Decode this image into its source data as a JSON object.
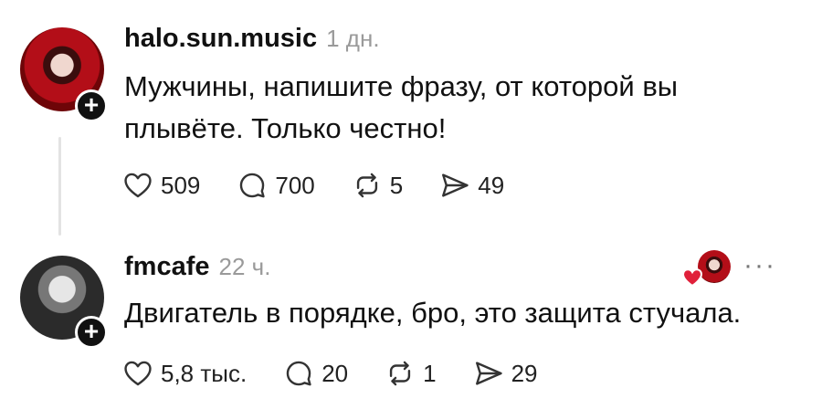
{
  "posts": [
    {
      "username": "halo.sun.music",
      "time": "1 дн.",
      "text": "Мужчины, напишите фразу, от которой вы плывёте. Только честно!",
      "likes": "509",
      "replies": "700",
      "reposts": "5",
      "shares": "49"
    },
    {
      "username": "fmcafe",
      "time": "22 ч.",
      "text": "Двигатель в порядке, бро, это защита стучала.",
      "likes": "5,8 тыс.",
      "replies": "20",
      "reposts": "1",
      "shares": "29"
    }
  ],
  "follow_symbol": "+",
  "more_symbol": "···",
  "colors": {
    "liked_heart": "#e0203a",
    "muted_text": "#9a9a9a",
    "thread_line": "#e3e3e3"
  },
  "icons": [
    "heart-icon",
    "reply-icon",
    "repost-icon",
    "share-icon",
    "plus-icon",
    "more-icon"
  ]
}
